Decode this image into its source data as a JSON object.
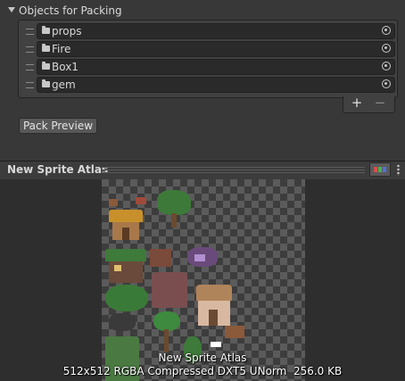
{
  "packing": {
    "title": "Objects for Packing",
    "items": [
      {
        "label": "props",
        "icon": "folder-icon"
      },
      {
        "label": "Fire",
        "icon": "folder-icon"
      },
      {
        "label": "Box1",
        "icon": "folder-icon"
      },
      {
        "label": "gem",
        "icon": "folder-icon"
      }
    ],
    "add_label": "+",
    "remove_label": "−",
    "pack_preview_label": "Pack Preview"
  },
  "preview": {
    "title": "New Sprite Atlas",
    "atlas_name": "New Sprite Atlas",
    "atlas_info": "512x512 RGBA Compressed DXT5 UNorm  256.0 KB"
  },
  "colors": {
    "background": "#383838",
    "field": "#2a2a2a",
    "checker_light": "#5b5b5b",
    "checker_dark": "#3d3d3d"
  }
}
